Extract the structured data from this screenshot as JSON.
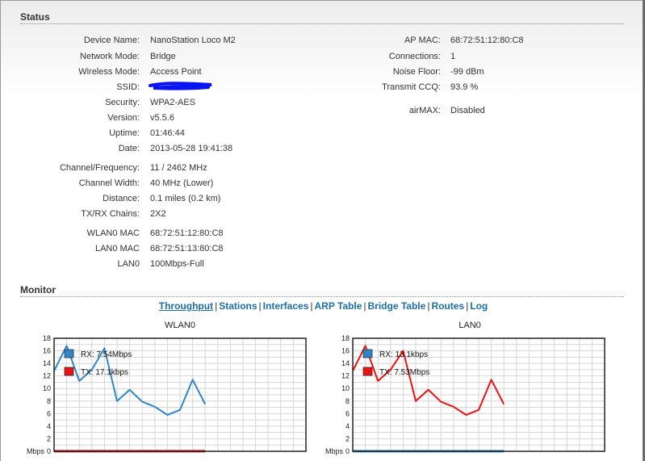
{
  "status": {
    "title": "Status",
    "left": [
      {
        "label": "Device Name:",
        "value": "NanoStation Loco M2"
      },
      {
        "label": "Network Mode:",
        "value": "Bridge"
      },
      {
        "label": "Wireless Mode:",
        "value": "Access Point"
      },
      {
        "label": "SSID:",
        "value": ""
      },
      {
        "label": "Security:",
        "value": "WPA2-AES"
      },
      {
        "label": "Version:",
        "value": "v5.5.6"
      },
      {
        "label": "Uptime:",
        "value": "01:46:44"
      },
      {
        "label": "Date:",
        "value": "2013-05-28 19:41:38"
      },
      {
        "label": "Channel/Frequency:",
        "value": "11 / 2462 MHz"
      },
      {
        "label": "Channel Width:",
        "value": "40 MHz (Lower)"
      },
      {
        "label": "Distance:",
        "value": "0.1 miles (0.2 km)"
      },
      {
        "label": "TX/RX Chains:",
        "value": "2X2"
      },
      {
        "label": "WLAN0 MAC",
        "value": "68:72:51:12:80:C8"
      },
      {
        "label": "LAN0 MAC",
        "value": "68:72:51:13:80:C8"
      },
      {
        "label": "LAN0",
        "value": "100Mbps-Full"
      }
    ],
    "right": [
      {
        "label": "AP MAC:",
        "value": "68:72:51:12:80:C8"
      },
      {
        "label": "Connections:",
        "value": "1"
      },
      {
        "label": "Noise Floor:",
        "value": "-99 dBm"
      },
      {
        "label": "Transmit CCQ:",
        "value": "93.9 %"
      },
      {
        "label": "airMAX:",
        "value": "Disabled"
      }
    ]
  },
  "monitor": {
    "title": "Monitor",
    "tabs": [
      "Throughput",
      "Stations",
      "Interfaces",
      "ARP Table",
      "Bridge Table",
      "Routes",
      "Log"
    ],
    "active_tab": "Throughput"
  },
  "colors": {
    "rx": "#2e86c8",
    "tx": "#ee1111",
    "link": "#1a6fa8"
  },
  "chart_data": [
    {
      "type": "line",
      "title": "WLAN0",
      "ylabel": "Mbps",
      "ylim": [
        0,
        18
      ],
      "yticks": [
        0,
        2,
        4,
        6,
        8,
        10,
        12,
        14,
        16,
        18
      ],
      "x": [
        0,
        1,
        2,
        3,
        4,
        5,
        6,
        7,
        8,
        9,
        10,
        11,
        12,
        13,
        14,
        15,
        16,
        17,
        18,
        19,
        20
      ],
      "series": [
        {
          "name": "RX: 7.54Mbps",
          "color": "#2e86c8",
          "values": [
            12.8,
            16.8,
            11.2,
            13.0,
            16.4,
            8.0,
            9.8,
            7.9,
            7.1,
            5.8,
            6.6,
            11.4,
            7.5
          ]
        },
        {
          "name": "TX: 17.1kbps",
          "color": "#ee1111",
          "values": [
            0.02,
            0.02,
            0.02,
            0.02,
            0.02,
            0.02,
            0.02,
            0.02,
            0.02,
            0.02,
            0.02,
            0.02,
            0.02
          ]
        }
      ]
    },
    {
      "type": "line",
      "title": "LAN0",
      "ylabel": "Mbps",
      "ylim": [
        0,
        18
      ],
      "yticks": [
        0,
        2,
        4,
        6,
        8,
        10,
        12,
        14,
        16,
        18
      ],
      "x": [
        0,
        1,
        2,
        3,
        4,
        5,
        6,
        7,
        8,
        9,
        10,
        11,
        12,
        13,
        14,
        15,
        16,
        17,
        18,
        19,
        20
      ],
      "series": [
        {
          "name": "RX: 13.1kbps",
          "color": "#2e86c8",
          "values": [
            0.02,
            0.02,
            0.02,
            0.02,
            0.02,
            0.02,
            0.02,
            0.02,
            0.02,
            0.02,
            0.02,
            0.02,
            0.02
          ]
        },
        {
          "name": "TX: 7.53Mbps",
          "color": "#ee1111",
          "values": [
            12.8,
            16.8,
            11.2,
            13.0,
            16.0,
            8.0,
            9.8,
            7.9,
            7.1,
            5.8,
            6.6,
            11.4,
            7.5
          ]
        }
      ]
    }
  ]
}
